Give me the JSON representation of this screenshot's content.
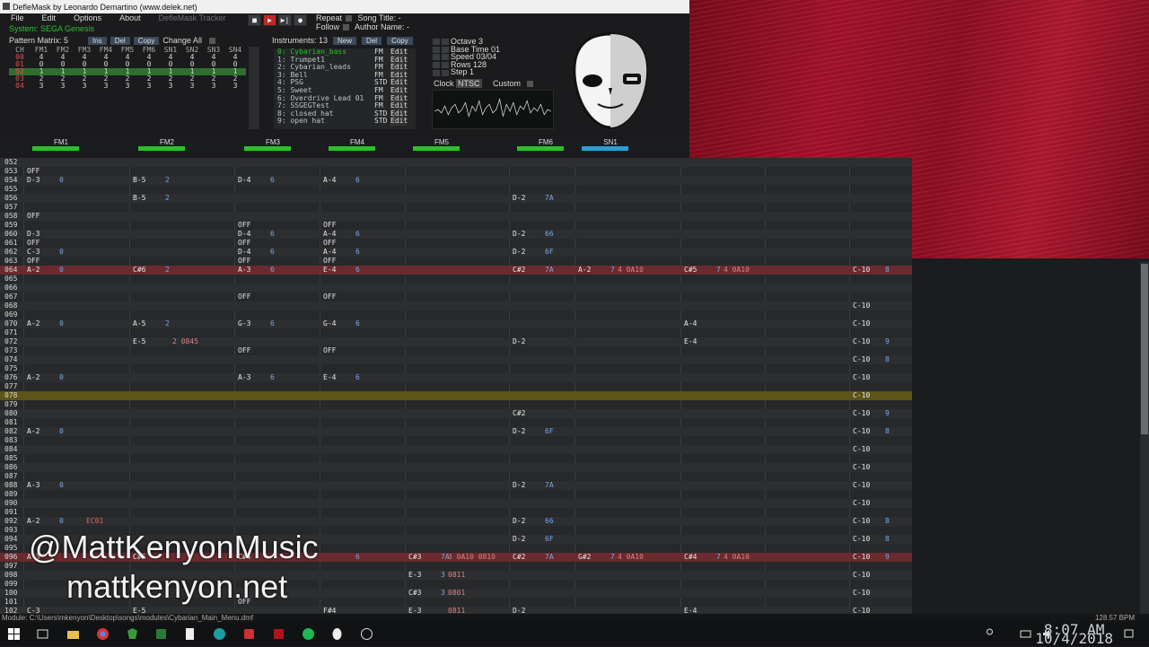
{
  "window": {
    "title": "DefleMask by Leonardo Demartino (www.delek.net)"
  },
  "menu": {
    "items": [
      "File",
      "Edit",
      "Options",
      "About"
    ],
    "brand": "DefleMask Tracker"
  },
  "system": "System: SEGA Genesis",
  "transport": {
    "repeat_label": "Repeat",
    "follow_label": "Follow",
    "song_title_label": "Song Title: -",
    "author_label": "Author Name: -"
  },
  "pattern_matrix": {
    "label": "Pattern Matrix: 5",
    "ins": "Ins",
    "del": "Del",
    "copy": "Copy",
    "change_all": "Change All",
    "channels": [
      "CH",
      "FM1",
      "FM2",
      "FM3",
      "FM4",
      "FM5",
      "FM6",
      "SN1",
      "SN2",
      "SN3",
      "SN4"
    ],
    "rows": [
      [
        "00",
        "4",
        "4",
        "4",
        "4",
        "4",
        "4",
        "4",
        "4",
        "4",
        "4"
      ],
      [
        "01",
        "0",
        "0",
        "0",
        "0",
        "0",
        "0",
        "0",
        "0",
        "0",
        "0"
      ],
      [
        "02",
        "1",
        "1",
        "1",
        "1",
        "1",
        "1",
        "1",
        "1",
        "1",
        "1"
      ],
      [
        "03",
        "2",
        "2",
        "2",
        "2",
        "2",
        "2",
        "2",
        "2",
        "2",
        "2"
      ],
      [
        "04",
        "3",
        "3",
        "3",
        "3",
        "3",
        "3",
        "3",
        "3",
        "3",
        "3"
      ]
    ]
  },
  "instruments": {
    "label": "Instruments: 13",
    "new": "New",
    "del": "Del",
    "copy": "Copy",
    "edit": "Edit",
    "list": [
      {
        "name": "0: Cybarian_bass",
        "type": "FM"
      },
      {
        "name": "1: Trumpet1",
        "type": "FM"
      },
      {
        "name": "2: Cybarian_leads",
        "type": "FM"
      },
      {
        "name": "3: Bell",
        "type": "FM"
      },
      {
        "name": "4: PSG",
        "type": "STD"
      },
      {
        "name": "5: Sweet",
        "type": "FM"
      },
      {
        "name": "6: Overdrive Lead 01",
        "type": "FM"
      },
      {
        "name": "7: SSGEGTest",
        "type": "FM"
      },
      {
        "name": "8: closed hat",
        "type": "STD"
      },
      {
        "name": "9: open hat",
        "type": "STD"
      }
    ]
  },
  "settings": {
    "octave": "Octave 3",
    "base_time": "Base Time 01",
    "speed": "Speed 03/04",
    "rows": "Rows 128",
    "step": "Step 1",
    "clock": "Clock",
    "ntsc": "NTSC",
    "custom": "Custom"
  },
  "channel_headers": [
    "FM1",
    "FM2",
    "FM3",
    "FM4",
    "FM5",
    "FM6",
    "SN1"
  ],
  "pattern_rows": [
    {
      "n": "052",
      "c": []
    },
    {
      "n": "053",
      "c": [
        [
          "OFF",
          "n",
          0
        ]
      ]
    },
    {
      "n": "054",
      "c": [
        [
          "D-3",
          "n",
          0
        ],
        [
          "0",
          "i",
          0
        ],
        [
          "B-5",
          "n",
          1
        ],
        [
          "2",
          "i",
          1
        ],
        [
          "D-4",
          "n",
          2
        ],
        [
          "6",
          "i",
          2
        ],
        [
          "A-4",
          "n",
          3
        ],
        [
          "6",
          "i",
          3
        ]
      ]
    },
    {
      "n": "055",
      "c": []
    },
    {
      "n": "056",
      "c": [
        [
          "B-5",
          "n",
          1
        ],
        [
          "2",
          "i",
          1
        ],
        [
          "D-2",
          "n",
          5
        ],
        [
          "7A",
          "i",
          5
        ]
      ]
    },
    {
      "n": "057",
      "c": []
    },
    {
      "n": "058",
      "c": [
        [
          "OFF",
          "n",
          0
        ]
      ]
    },
    {
      "n": "059",
      "c": [
        [
          "OFF",
          "n",
          2
        ],
        [
          "OFF",
          "n",
          3
        ]
      ]
    },
    {
      "n": "060",
      "c": [
        [
          "D-3",
          "n",
          0
        ],
        [
          "D-4",
          "n",
          2
        ],
        [
          "6",
          "i",
          2
        ],
        [
          "A-4",
          "n",
          3
        ],
        [
          "6",
          "i",
          3
        ],
        [
          "D-2",
          "n",
          5
        ],
        [
          "66",
          "i",
          5
        ]
      ]
    },
    {
      "n": "061",
      "c": [
        [
          "OFF",
          "n",
          0
        ],
        [
          "OFF",
          "n",
          2
        ],
        [
          "OFF",
          "n",
          3
        ]
      ]
    },
    {
      "n": "062",
      "c": [
        [
          "C-3",
          "n",
          0
        ],
        [
          "0",
          "i",
          0
        ],
        [
          "D-4",
          "n",
          2
        ],
        [
          "6",
          "i",
          2
        ],
        [
          "A-4",
          "n",
          3
        ],
        [
          "6",
          "i",
          3
        ],
        [
          "D-2",
          "n",
          5
        ],
        [
          "6F",
          "i",
          5
        ]
      ]
    },
    {
      "n": "063",
      "c": [
        [
          "OFF",
          "n",
          0
        ],
        [
          "OFF",
          "n",
          2
        ],
        [
          "OFF",
          "n",
          3
        ]
      ]
    },
    {
      "n": "064",
      "cur": true,
      "c": [
        [
          "A-2",
          "n",
          0
        ],
        [
          "0",
          "i",
          0
        ],
        [
          "C#6",
          "n",
          1
        ],
        [
          "2",
          "i",
          1
        ],
        [
          "A-3",
          "n",
          2
        ],
        [
          "6",
          "i",
          2
        ],
        [
          "E-4",
          "n",
          3
        ],
        [
          "6",
          "i",
          3
        ],
        [
          "C#2",
          "n",
          5
        ],
        [
          "7A",
          "i",
          5
        ],
        [
          "A-2",
          "n",
          6
        ],
        [
          "7",
          "i",
          6
        ],
        [
          "4 0A10",
          "v",
          6
        ],
        [
          "C#5",
          "n",
          7
        ],
        [
          "7",
          "i",
          7
        ],
        [
          "4 0A10",
          "v",
          7
        ],
        [
          "C-10",
          "n",
          9
        ],
        [
          "8",
          "i",
          9
        ]
      ]
    },
    {
      "n": "065",
      "c": []
    },
    {
      "n": "066",
      "c": []
    },
    {
      "n": "067",
      "c": [
        [
          "OFF",
          "n",
          2
        ],
        [
          "OFF",
          "n",
          3
        ]
      ]
    },
    {
      "n": "068",
      "c": [
        [
          "C-10",
          "n",
          9
        ]
      ]
    },
    {
      "n": "069",
      "c": []
    },
    {
      "n": "070",
      "c": [
        [
          "A-2",
          "n",
          0
        ],
        [
          "0",
          "i",
          0
        ],
        [
          "A-5",
          "n",
          1
        ],
        [
          "2",
          "i",
          1
        ],
        [
          "G-3",
          "n",
          2
        ],
        [
          "6",
          "i",
          2
        ],
        [
          "G-4",
          "n",
          3
        ],
        [
          "6",
          "i",
          3
        ],
        [
          "A-4",
          "n",
          7
        ],
        [
          "C-10",
          "n",
          9
        ]
      ]
    },
    {
      "n": "071",
      "c": []
    },
    {
      "n": "072",
      "c": [
        [
          "E-5",
          "n",
          1
        ],
        [
          "2 0845",
          "v",
          1
        ],
        [
          "D-2",
          "n",
          5
        ],
        [
          "E-4",
          "n",
          7
        ],
        [
          "C-10",
          "n",
          9
        ],
        [
          "9",
          "i",
          9
        ]
      ]
    },
    {
      "n": "073",
      "c": [
        [
          "OFF",
          "n",
          2
        ],
        [
          "OFF",
          "n",
          3
        ]
      ]
    },
    {
      "n": "074",
      "c": [
        [
          "C-10",
          "n",
          9
        ],
        [
          "8",
          "i",
          9
        ]
      ]
    },
    {
      "n": "075",
      "c": []
    },
    {
      "n": "076",
      "c": [
        [
          "A-2",
          "n",
          0
        ],
        [
          "0",
          "i",
          0
        ],
        [
          "A-3",
          "n",
          2
        ],
        [
          "6",
          "i",
          2
        ],
        [
          "E-4",
          "n",
          3
        ],
        [
          "6",
          "i",
          3
        ],
        [
          "C-10",
          "n",
          9
        ]
      ]
    },
    {
      "n": "077",
      "c": []
    },
    {
      "n": "078",
      "yel": true,
      "c": [
        [
          "C-10",
          "n",
          9
        ]
      ]
    },
    {
      "n": "079",
      "c": []
    },
    {
      "n": "080",
      "c": [
        [
          "C#2",
          "n",
          5
        ],
        [
          "C-10",
          "n",
          9
        ],
        [
          "9",
          "i",
          9
        ]
      ]
    },
    {
      "n": "081",
      "c": []
    },
    {
      "n": "082",
      "c": [
        [
          "A-2",
          "n",
          0
        ],
        [
          "0",
          "i",
          0
        ],
        [
          "D-2",
          "n",
          5
        ],
        [
          "6F",
          "i",
          5
        ],
        [
          "C-10",
          "n",
          9
        ],
        [
          "8",
          "i",
          9
        ]
      ]
    },
    {
      "n": "083",
      "c": []
    },
    {
      "n": "084",
      "c": [
        [
          "C-10",
          "n",
          9
        ]
      ]
    },
    {
      "n": "085",
      "c": []
    },
    {
      "n": "086",
      "c": [
        [
          "C-10",
          "n",
          9
        ]
      ]
    },
    {
      "n": "087",
      "c": []
    },
    {
      "n": "088",
      "c": [
        [
          "A-3",
          "n",
          0
        ],
        [
          "0",
          "i",
          0
        ],
        [
          "D-2",
          "n",
          5
        ],
        [
          "7A",
          "i",
          5
        ],
        [
          "C-10",
          "n",
          9
        ]
      ]
    },
    {
      "n": "089",
      "c": []
    },
    {
      "n": "090",
      "c": [
        [
          "C-10",
          "n",
          9
        ]
      ]
    },
    {
      "n": "091",
      "c": []
    },
    {
      "n": "092",
      "c": [
        [
          "A-2",
          "n",
          0
        ],
        [
          "0",
          "i",
          0
        ],
        [
          "EC01",
          "f",
          0
        ],
        [
          "D-2",
          "n",
          5
        ],
        [
          "66",
          "i",
          5
        ],
        [
          "C-10",
          "n",
          9
        ],
        [
          "8",
          "i",
          9
        ]
      ]
    },
    {
      "n": "093",
      "c": []
    },
    {
      "n": "094",
      "c": [
        [
          "D-2",
          "n",
          5
        ],
        [
          "6F",
          "i",
          5
        ],
        [
          "C-10",
          "n",
          9
        ],
        [
          "8",
          "i",
          9
        ]
      ]
    },
    {
      "n": "095",
      "c": []
    },
    {
      "n": "096",
      "cur": true,
      "c": [
        [
          "A-3",
          "n",
          0
        ],
        [
          "C#5",
          "n",
          1
        ],
        [
          "C#4",
          "n",
          2
        ],
        [
          "6",
          "i",
          3
        ],
        [
          "C#3",
          "n",
          4
        ],
        [
          "7A",
          "i",
          4
        ],
        [
          "3 0A10 0810",
          "v",
          4
        ],
        [
          "C#2",
          "n",
          5
        ],
        [
          "7A",
          "i",
          5
        ],
        [
          "G#2",
          "n",
          6
        ],
        [
          "7",
          "i",
          6
        ],
        [
          "4 0A10",
          "v",
          6
        ],
        [
          "C#4",
          "n",
          7
        ],
        [
          "7",
          "i",
          7
        ],
        [
          "4 0A10",
          "v",
          7
        ],
        [
          "C-10",
          "n",
          9
        ],
        [
          "9",
          "i",
          9
        ]
      ]
    },
    {
      "n": "097",
      "c": []
    },
    {
      "n": "098",
      "c": [
        [
          "E-3",
          "n",
          4
        ],
        [
          "3",
          "i",
          4
        ],
        [
          "0811",
          "v",
          4
        ],
        [
          "C-10",
          "n",
          9
        ]
      ]
    },
    {
      "n": "099",
      "c": []
    },
    {
      "n": "100",
      "c": [
        [
          "C#3",
          "n",
          4
        ],
        [
          "3",
          "i",
          4
        ],
        [
          "0801",
          "v",
          4
        ],
        [
          "C-10",
          "n",
          9
        ]
      ]
    },
    {
      "n": "101",
      "c": [
        [
          "OFF",
          "n",
          2
        ]
      ]
    },
    {
      "n": "102",
      "c": [
        [
          "C-3",
          "n",
          0
        ],
        [
          "E-5",
          "n",
          1
        ],
        [
          "F#4",
          "n",
          3
        ],
        [
          "E-3",
          "n",
          4
        ],
        [
          "0811",
          "v",
          4
        ],
        [
          "D-2",
          "n",
          5
        ],
        [
          "E-4",
          "n",
          7
        ],
        [
          "C-10",
          "n",
          9
        ]
      ]
    }
  ],
  "watermark": {
    "line1": "@MattKenyonMusic",
    "line2": "mattkenyon.net"
  },
  "status": {
    "module": "Module: C:\\Users\\mkenyon\\Desktop\\songs\\modules\\Cybarian_Main_Menu.dmf",
    "bpm": "128.57 BPM"
  },
  "taskbar": {
    "time": "8:07 AM",
    "date": "10/4/2018"
  }
}
